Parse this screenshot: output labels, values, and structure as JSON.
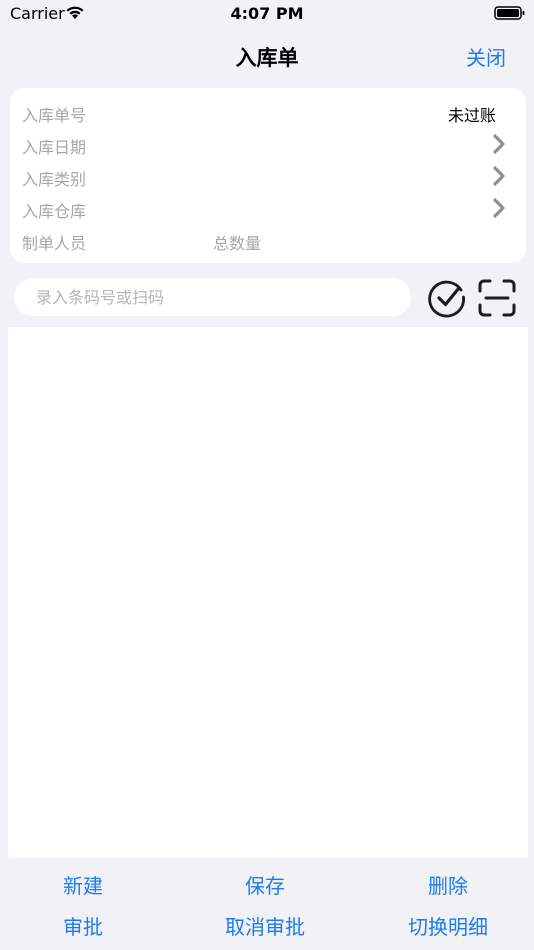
{
  "status_bar": {
    "carrier": "Carrier",
    "time": "4:07 PM"
  },
  "nav": {
    "title": "入库单",
    "close_label": "关闭"
  },
  "info": {
    "order_no_label": "入库单号",
    "order_status": "未过账",
    "date_label": "入库日期",
    "type_label": "入库类别",
    "warehouse_label": "入库仓库",
    "creator_label": "制单人员",
    "total_label": "总数量"
  },
  "search": {
    "placeholder": "录入条码号或扫码"
  },
  "toolbar": {
    "new_label": "新建",
    "save_label": "保存",
    "delete_label": "删除",
    "approve_label": "审批",
    "cancel_approve_label": "取消审批",
    "toggle_detail_label": "切换明细"
  },
  "colors": {
    "accent": "#1a7cf0",
    "background": "#f2f2f6",
    "label_gray": "#a7a7ab"
  }
}
